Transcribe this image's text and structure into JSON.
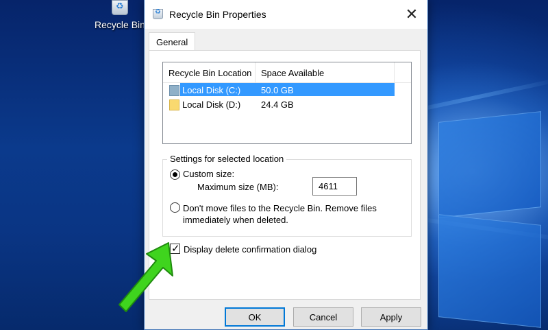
{
  "desktop": {
    "icon_label": "Recycle Bin"
  },
  "dialog": {
    "title": "Recycle Bin Properties",
    "close_glyph": "✕",
    "tabs": [
      {
        "label": "General",
        "active": true
      }
    ],
    "list": {
      "columns": [
        "Recycle Bin Location",
        "Space Available"
      ],
      "rows": [
        {
          "name": "Local Disk (C:)",
          "space": "50.0 GB",
          "selected": true
        },
        {
          "name": "Local Disk (D:)",
          "space": "24.4 GB",
          "selected": false
        }
      ]
    },
    "settings": {
      "legend": "Settings for selected location",
      "custom_size_label": "Custom size:",
      "custom_size_selected": true,
      "max_size_label": "Maximum size (MB):",
      "max_size_value": "4611",
      "dont_move_label": "Don't move files to the Recycle Bin. Remove files immediately when deleted.",
      "dont_move_selected": false
    },
    "confirm_checkbox": {
      "label": "Display delete confirmation dialog",
      "checked": true
    },
    "buttons": {
      "ok": "OK",
      "cancel": "Cancel",
      "apply": "Apply"
    }
  },
  "colors": {
    "selection": "#3399ff",
    "accent_border": "#0078d7",
    "arrow": "#3fd41e"
  }
}
